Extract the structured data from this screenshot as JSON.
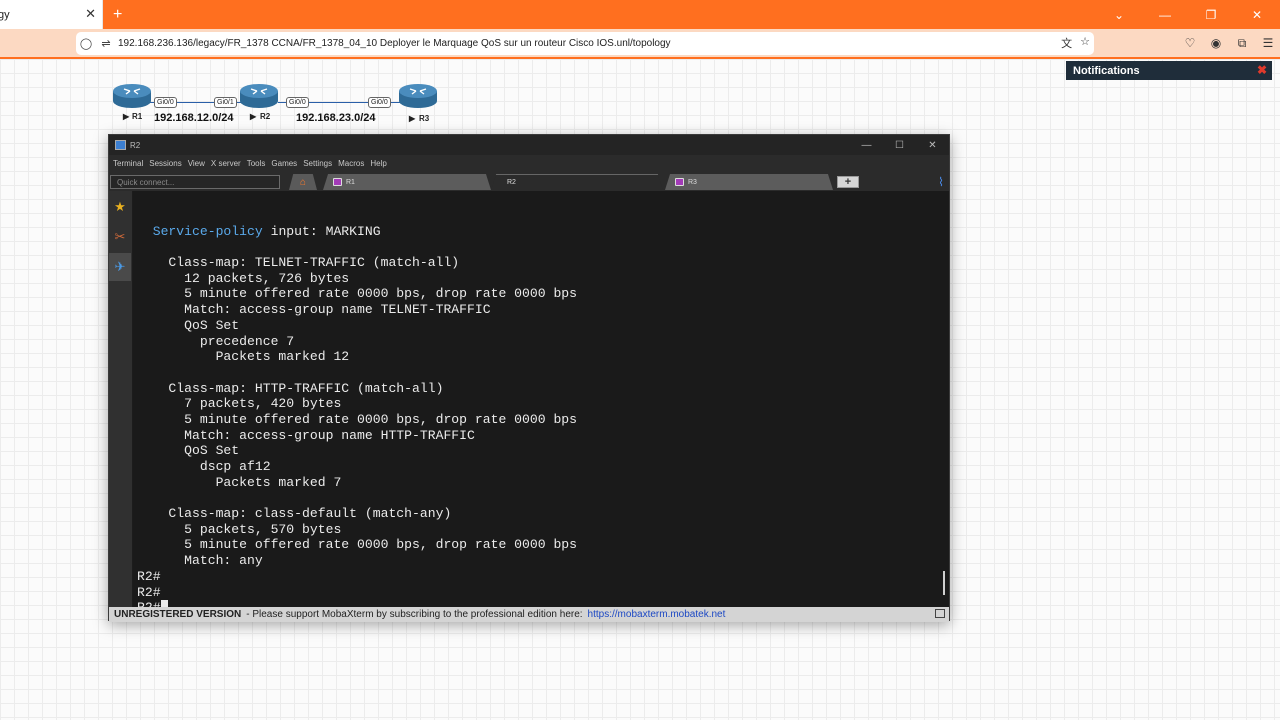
{
  "browser": {
    "tab_title": "gy",
    "url": "192.168.236.136/legacy/FR_1378 CCNA/FR_1378_04_10 Deployer le Marquage QoS sur un routeur Cisco IOS.unl/topology"
  },
  "topology": {
    "routers": [
      {
        "label": "R1"
      },
      {
        "label": "R2"
      },
      {
        "label": "R3"
      }
    ],
    "interfaces": [
      "Gi0/0",
      "Gi0/1",
      "Gi0/0",
      "Gi0/0"
    ],
    "networks": [
      "192.168.12.0/24",
      "192.168.23.0/24"
    ]
  },
  "notifications": {
    "title": "Notifications"
  },
  "moba": {
    "window_title": "R2",
    "menu": [
      "Terminal",
      "Sessions",
      "View",
      "X server",
      "Tools",
      "Games",
      "Settings",
      "Macros",
      "Help"
    ],
    "quick_connect_placeholder": "Quick connect...",
    "tabs": [
      {
        "label": "R1",
        "active": false
      },
      {
        "label": "R2",
        "active": true
      },
      {
        "label": "R3",
        "active": false
      }
    ],
    "status": {
      "unregistered": "UNREGISTERED VERSION",
      "message": "-  Please support MobaXterm by subscribing to the professional edition here:",
      "link": "https://mobaxterm.mobatek.net"
    }
  },
  "terminal": {
    "lines": [
      "",
      "  Service-policy input: MARKING",
      "",
      "    Class-map: TELNET-TRAFFIC (match-all)",
      "      12 packets, 726 bytes",
      "      5 minute offered rate 0000 bps, drop rate 0000 bps",
      "      Match: access-group name TELNET-TRAFFIC",
      "      QoS Set",
      "        precedence 7",
      "          Packets marked 12",
      "",
      "    Class-map: HTTP-TRAFFIC (match-all)",
      "      7 packets, 420 bytes",
      "      5 minute offered rate 0000 bps, drop rate 0000 bps",
      "      Match: access-group name HTTP-TRAFFIC",
      "      QoS Set",
      "        dscp af12",
      "          Packets marked 7",
      "",
      "    Class-map: class-default (match-any)",
      "      5 packets, 570 bytes",
      "      5 minute offered rate 0000 bps, drop rate 0000 bps",
      "      Match: any",
      "R2#",
      "R2#",
      "R2#"
    ]
  },
  "colors": {
    "browser_accent": "#ff6f1f",
    "terminal_bg": "#1a1a1a",
    "terminal_fg": "#ebebeb",
    "terminal_highlight": "#5aa9ea"
  }
}
